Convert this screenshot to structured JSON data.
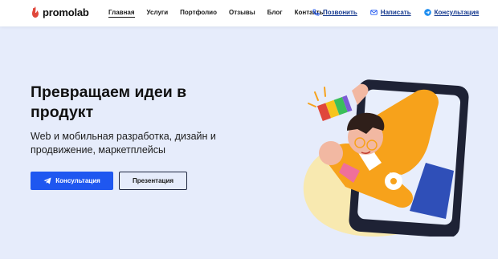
{
  "header": {
    "logo_text": "promolab",
    "nav": [
      "Главная",
      "Услуги",
      "Портфолио",
      "Отзывы",
      "Блог",
      "Контакты"
    ],
    "actions": {
      "call": "Позвонить",
      "write": "Написать",
      "consult": "Консультация"
    }
  },
  "hero": {
    "title": "Превращаем идеи в продукт",
    "subtitle": "Web и мобильная разработка, дизайн и продвижение, маркетплейсы",
    "primary_button": "Консультация",
    "secondary_button": "Презентация"
  },
  "colors": {
    "brand_red": "#e0473b",
    "accent_blue": "#1f57f0",
    "link_blue": "#163a8f",
    "hero_background": "#e6ecfb",
    "illustration_orange": "#f7a21b"
  },
  "icons": [
    "phone-icon",
    "mail-icon",
    "telegram-icon",
    "logo-mark-icon"
  ]
}
